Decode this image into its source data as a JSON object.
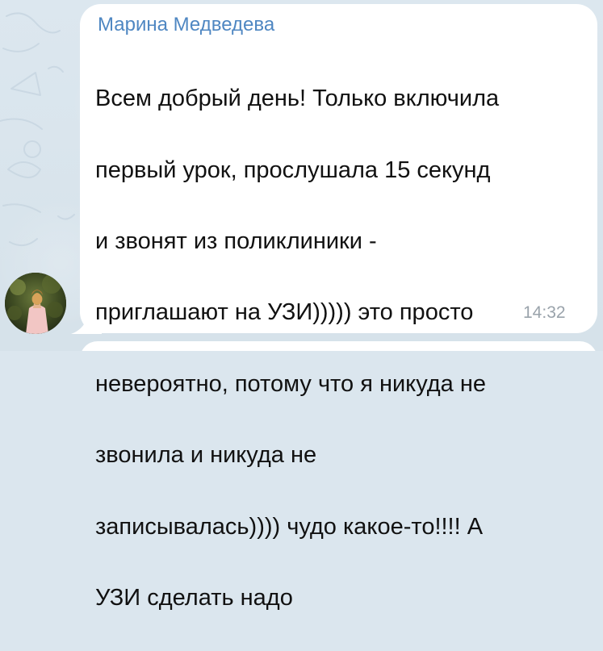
{
  "message": {
    "sender_name": "Марина Медведева",
    "lines": [
      "Всем добрый день! Только включила",
      "первый урок, прослушала 15 секунд",
      "и звонят из поликлиники -",
      "приглашают на УЗИ))))) это просто",
      "невероятно, потому что я никуда не",
      "звонила и никуда не",
      "записывалась)))) чудо какое-то!!!! А",
      "УЗИ сделать надо"
    ],
    "time": "14:32"
  },
  "colors": {
    "sender_name": "#4f87c2",
    "bubble": "#ffffff",
    "background": "#dbe6ee",
    "timestamp": "#9aa3ab"
  },
  "avatar": {
    "icon": "avatar-photo-icon"
  }
}
